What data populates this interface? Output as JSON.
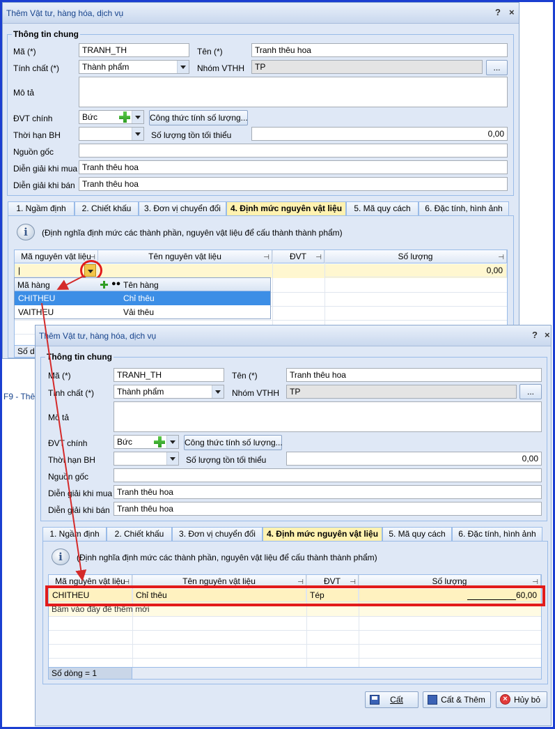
{
  "dialog_back": {
    "title": "Thêm Vật tư, hàng hóa, dịch vụ",
    "help": "?",
    "close": "×",
    "group_title": "Thông tin chung",
    "ma_label": "Mã (*)",
    "ma_value": "TRANH_TH",
    "ten_label": "Tên (*)",
    "ten_value": "Tranh thêu hoa",
    "tinhchat_label": "Tính chất (*)",
    "tinhchat_value": "Thành phẩm",
    "nhom_label": "Nhóm VTHH",
    "nhom_value": "TP",
    "nhom_button": "...",
    "mota_label": "Mô tả",
    "dvt_label": "ĐVT chính",
    "dvt_value": "Bức",
    "congthuc_button": "Công thức tính số lượng...",
    "thoihan_label": "Thời hạn BH",
    "soluongton_label": "Số lượng tồn tối thiểu",
    "soluongton_value": "0,00",
    "nguongoc_label": "Nguồn gốc",
    "diengiaimua_label": "Diễn giải khi mua",
    "diengiaimua_value": "Tranh thêu hoa",
    "diengiaiban_label": "Diễn giải khi bán",
    "diengiaiban_value": "Tranh thêu hoa",
    "tabs": [
      "1. Ngầm định",
      "2. Chiết khấu",
      "3. Đơn vị chuyển đổi",
      "4. Định mức nguyên vật liệu",
      "5. Mã quy cách",
      "6. Đặc tính, hình ảnh"
    ],
    "info_text": "(Định nghĩa định mức các thành phần, nguyên vật liệu để cấu thành thành phẩm)",
    "grid_headers": [
      "Mã nguyên vật liệu",
      "Tên nguyên vật liệu",
      "ĐVT",
      "Số lượng"
    ],
    "edit_row_qty": "0,00",
    "edit_row_text": "|",
    "dropdown_headers": [
      "Mã hàng",
      "Tên hàng"
    ],
    "dropdown_rows": [
      {
        "code": "CHITHEU",
        "name": "Chỉ thêu"
      },
      {
        "code": "VAITHEU",
        "name": "Vải thêu"
      }
    ],
    "status_text": "Số dò",
    "behind_text": "F9 - Thê"
  },
  "dialog_front": {
    "title": "Thêm Vật tư, hàng hóa, dịch vụ",
    "help": "?",
    "close": "×",
    "group_title": "Thông tin chung",
    "ma_label": "Mã (*)",
    "ma_value": "TRANH_TH",
    "ten_label": "Tên (*)",
    "ten_value": "Tranh thêu hoa",
    "tinhchat_label": "Tính chất (*)",
    "tinhchat_value": "Thành phẩm",
    "nhom_label": "Nhóm VTHH",
    "nhom_value": "TP",
    "nhom_button": "...",
    "mota_label": "Mô tả",
    "dvt_label": "ĐVT chính",
    "dvt_value": "Bức",
    "congthuc_button": "Công thức tính số lượng...",
    "thoihan_label": "Thời hạn BH",
    "soluongton_label": "Số lượng tồn tối thiểu",
    "soluongton_value": "0,00",
    "nguongoc_label": "Nguồn gốc",
    "diengiaimua_label": "Diễn giải khi mua",
    "diengiaimua_value": "Tranh thêu hoa",
    "diengiaiban_label": "Diễn giải khi bán",
    "diengiaiban_value": "Tranh thêu hoa",
    "tabs": [
      "1. Ngầm định",
      "2. Chiết khấu",
      "3. Đơn vị chuyển đổi",
      "4. Định mức nguyên vật liệu",
      "5. Mã quy cách",
      "6. Đặc tính, hình ảnh"
    ],
    "info_text": "(Định nghĩa định mức các thành phần, nguyên vật liệu để cấu thành thành phẩm)",
    "grid_headers": [
      "Mã nguyên vật liệu",
      "Tên nguyên vật liệu",
      "ĐVT",
      "Số lượng"
    ],
    "row": {
      "code": "CHITHEU",
      "name": "Chỉ thêu",
      "unit": "Tép",
      "qty": "60,00"
    },
    "add_row_hint": "Bấm vào đây để thêm mới",
    "status_text": "Số dòng = 1",
    "save_button": "Cất",
    "save_new_button": "Cất & Thêm",
    "cancel_button": "Hủy bỏ"
  },
  "colors": {
    "annotation_red": "#e21b1b",
    "frame_blue": "#1b3fd1",
    "dialog_bg": "#dfe8f6",
    "active_tab": "#fff2b0",
    "selected_row": "#3c8ee6"
  }
}
